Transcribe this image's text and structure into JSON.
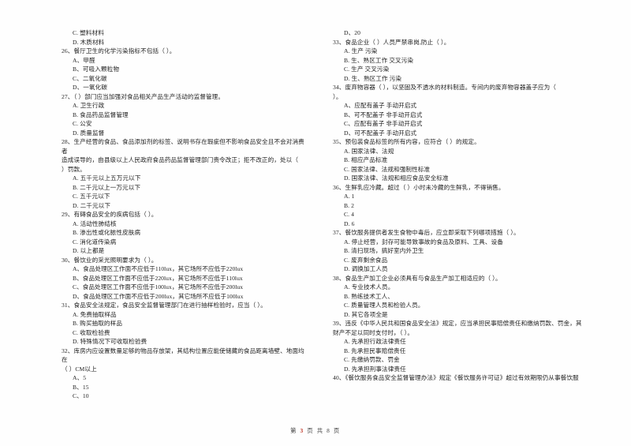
{
  "document": {
    "kind": "exam-paper",
    "language": "zh-CN"
  },
  "footer": {
    "prefix": "第",
    "page_number": "3",
    "middle": "页 共",
    "total_pages": "8",
    "suffix": "页"
  },
  "left_column": {
    "leading_options": [
      "C. 塑料材料",
      "D. 木质材料"
    ],
    "questions": [
      {
        "number": "26、",
        "stem": "餐厅卫生的化学污染指标不包括（      ）。",
        "options": [
          "A、甲醛",
          "B、可吸入颗粒物",
          "C、二氧化碳",
          "D、一氧化碳"
        ]
      },
      {
        "number": "27、",
        "stem": "（      ）部门应当加强对食品相关产品生产活动的监督管理。",
        "options": [
          "A. 卫生行政",
          "B. 食品药品监督管理",
          "C. 公安",
          "D. 质量监督"
        ]
      },
      {
        "number": "28、",
        "stem": "生产经营的食品、食品添加剂的标签、说明书存在瑕疵但不影响食品安全且不会对消费者",
        "stem_line2": "造成误导的，由县级以上人民政府食品药品监督管理部门责令改正；拒不改正的，处以（",
        "stem_line3": "）罚款。",
        "options": [
          "A. 五千元以上五万元以下",
          "B. 二千元以上一万元以下",
          "C. 五千元以下",
          "D. 二千元以下"
        ]
      },
      {
        "number": "29、",
        "stem": "有碍食品安全的疾病包括（      ）。",
        "options": [
          "A. 活动性肺结核",
          "B. 渗出性或化脓性皮肤病",
          "C. 消化道传染病",
          "D. 以上都是"
        ]
      },
      {
        "number": "30、",
        "stem": "餐饮业的采光照明要求为（      ）。",
        "options": [
          "A、食品处理区工作面不应低于110lux，其它场所不应低于220lux",
          "B、食品处理区工作面不应低于220lux，其它场所不应低于110lux",
          "C、食品处理区工作面不应低于100lux，其它场所不应低于200lux",
          "D、食品处理区工作面不应低于200lux，其它场所不应低于100lux"
        ]
      },
      {
        "number": "31、",
        "stem": "食品安全法规定，食品安全监督管理部门在进行抽样检验时，应当（      ）。",
        "options": [
          "A. 免费抽取样品",
          "B. 购买抽取的样品",
          "C. 收取检验费",
          "D. 特殊情况下可收取检验费"
        ]
      },
      {
        "number": "32、",
        "stem": "库房内应设置数量足够的物品存放架，其结构位置应能使储藏的食品距离墙壁、地面均在",
        "stem_line2": "（      ）CM以上",
        "options": [
          "A、5",
          "B、15",
          "C、10"
        ]
      }
    ]
  },
  "right_column": {
    "leading_options": [
      "D、20"
    ],
    "questions": [
      {
        "number": "33、",
        "stem": "食品企业（      ）人员严禁串岗,防止（      ）。",
        "options": [
          "A. 生产  污染",
          "B. 生、熟区工作  交叉污染",
          "C. 生产  交叉污染",
          "D. 生、熟区工作  污染"
        ]
      },
      {
        "number": "34、",
        "stem": "废弃物容器（             ），以坚固及不透水的材料制造。专间内的废弃物容器盖子应为（",
        "stem_line2": "）。",
        "options": [
          "A、应配有盖子   手动开启式",
          "B、可不配盖子   非手动开启式",
          "C、应配有盖子   非手动开启式",
          "D、可不配盖子   手动开启式"
        ]
      },
      {
        "number": "35、",
        "stem": "预包装食品标签的所有内容，应符合（      ）的规定。",
        "options": [
          "A. 国家法律、法规",
          "B. 相应产品标准",
          "C. 国家法律、法规和强制性标准",
          "D. 国家法律、法规和相应食品安全标准"
        ]
      },
      {
        "number": "36、",
        "stem": "生鲜乳应冷藏。超过（      ）小时未冷藏的生鲜乳，不得销售。",
        "options": [
          "A. 1",
          "B. 2",
          "C. 4",
          "D. 6"
        ]
      },
      {
        "number": "37、",
        "stem": "餐饮服务提供者发生食物中毒后，应立即采取下列哪项措施（      ）。",
        "options": [
          "A. 停止经营，封存可能导致事故的食品及原料、工具、设备",
          "B. 清扫现场，搞好室内外卫生",
          "C. 废弃剩余食品",
          "D. 调换加工人员"
        ]
      },
      {
        "number": "38、",
        "stem": "食品生产加工企业必须具有与食品生产加工相适应的（      ）。",
        "options": [
          "A. 专业技术人员。",
          "B. 熟练技术工人、",
          "C. 质量管理人员和检验人员。",
          "D. 其它各项全是"
        ]
      },
      {
        "number": "39、",
        "stem": "违反《中华人民共和国食品安全法》规定，应当承担民事赔偿责任和缴纳罚款、罚金，其",
        "stem_line2": "财产不足以同时支付时，（      ）。",
        "options": [
          "A. 先承担行政法律责任",
          "B. 先承担民事赔偿责任",
          "C. 先缴纳罚款、罚金",
          "D. 先承担刑事法律责任"
        ]
      },
      {
        "number": "40、",
        "stem": "《餐饮服务食品安全监督管理办法》规定《餐饮服务许可证》超过有效期限仍从事餐饮服"
      }
    ]
  }
}
